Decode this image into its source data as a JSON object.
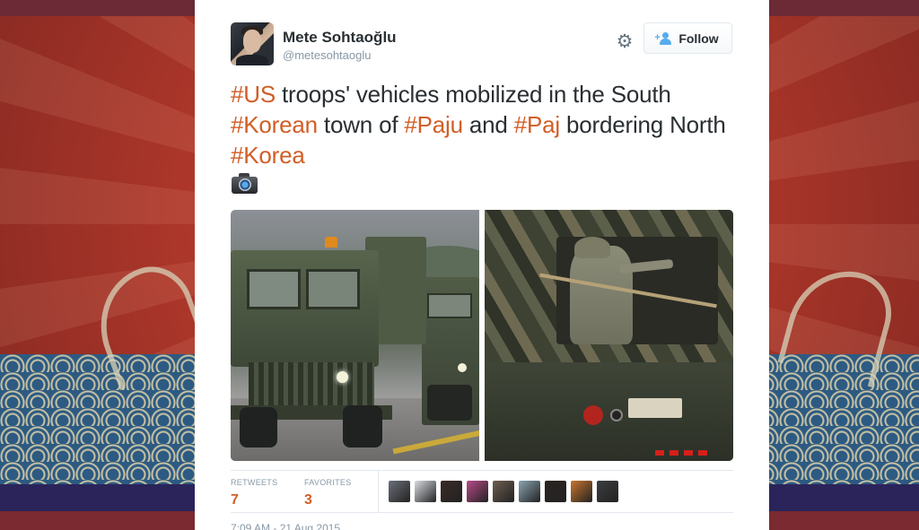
{
  "author": {
    "name": "Mete Sohtaoğlu",
    "handle": "@metesohtaoglu"
  },
  "actions": {
    "follow_label": "Follow",
    "settings_icon": "gear-icon",
    "follow_icon": "add-user-icon"
  },
  "tweet": {
    "segments": [
      {
        "text": "#US",
        "hashtag": true
      },
      {
        "text": " troops' vehicles mobilized in the South ",
        "hashtag": false
      },
      {
        "text": "#Korean",
        "hashtag": true
      },
      {
        "text": " town of ",
        "hashtag": false
      },
      {
        "text": "#Paju",
        "hashtag": true
      },
      {
        "text": " and ",
        "hashtag": false
      },
      {
        "text": "#Paj",
        "hashtag": true
      },
      {
        "text": " bordering North ",
        "hashtag": false
      },
      {
        "text": "#Korea",
        "hashtag": true
      }
    ],
    "media_icon": "camera-icon"
  },
  "stats": {
    "retweets_label": "RETWEETS",
    "retweets_value": "7",
    "favorites_label": "FAVORITES",
    "favorites_value": "3"
  },
  "favoriters": [
    {
      "name": "user-avatar-1",
      "color": "#6a6f78"
    },
    {
      "name": "user-avatar-2",
      "color": "#d9dde2"
    },
    {
      "name": "user-avatar-3",
      "color": "#3a2a26"
    },
    {
      "name": "user-avatar-4",
      "color": "#b74a8a"
    },
    {
      "name": "user-avatar-5",
      "color": "#6e5e50"
    },
    {
      "name": "user-avatar-6",
      "color": "#8aa3b0"
    },
    {
      "name": "user-avatar-7",
      "color": "#2a2421"
    },
    {
      "name": "user-avatar-8",
      "color": "#c8752f"
    },
    {
      "name": "user-avatar-9",
      "color": "#3c3d40"
    }
  ],
  "timestamp": "7:09 AM - 21 Aug 2015",
  "colors": {
    "link": "#d15e27",
    "text": "#292f33",
    "muted": "#8899a6"
  }
}
